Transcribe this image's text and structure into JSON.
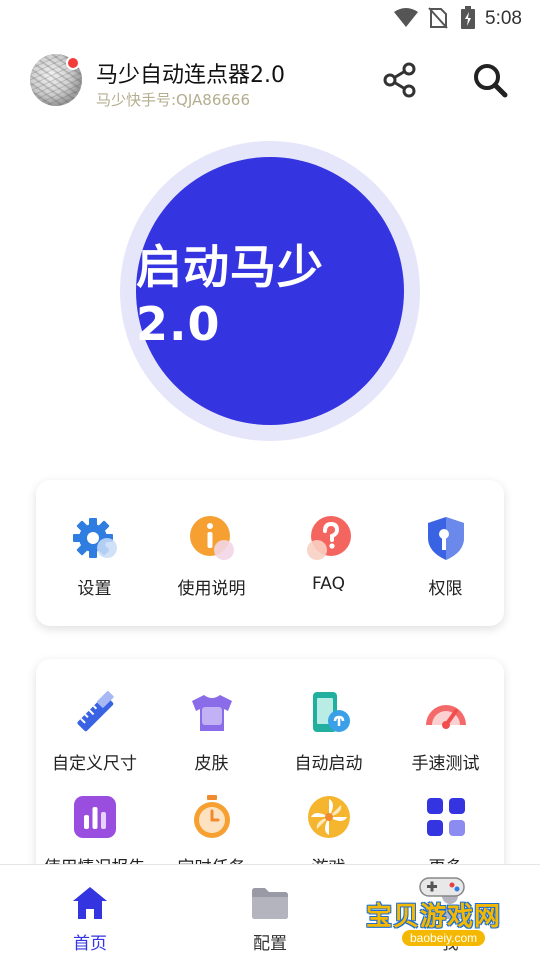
{
  "status_bar": {
    "time": "5:08",
    "wifi_icon": "wifi-icon",
    "sim_icon": "no-sim-icon",
    "battery_icon": "battery-charging-icon"
  },
  "header": {
    "title": "马少自动连点器2.0",
    "subtitle": "马少快手号:QJA86666",
    "share_icon": "share-icon",
    "search_icon": "search-icon"
  },
  "start_button": {
    "label": "启动马少2.0"
  },
  "colors": {
    "accent": "#3434e0",
    "ring": "#e6e6fb",
    "subtitle": "#b4ad8e",
    "badge": "#f23c3c"
  },
  "quick_menu": [
    {
      "label": "设置",
      "icon": "gear-icon"
    },
    {
      "label": "使用说明",
      "icon": "info-icon"
    },
    {
      "label": "FAQ",
      "icon": "question-icon"
    },
    {
      "label": "权限",
      "icon": "shield-key-icon"
    }
  ],
  "tools_menu": [
    {
      "label": "自定义尺寸",
      "icon": "ruler-pencil-icon"
    },
    {
      "label": "皮肤",
      "icon": "tshirt-icon"
    },
    {
      "label": "自动启动",
      "icon": "phone-link-icon"
    },
    {
      "label": "手速测试",
      "icon": "speedometer-icon"
    },
    {
      "label": "使用情况报告",
      "icon": "bar-chart-icon"
    },
    {
      "label": "定时任务",
      "icon": "stopwatch-icon"
    },
    {
      "label": "游戏",
      "icon": "pinwheel-icon"
    },
    {
      "label": "更多",
      "icon": "grid-icon"
    }
  ],
  "bottom_nav": [
    {
      "label": "首页",
      "icon": "home-icon",
      "active": true
    },
    {
      "label": "配置",
      "icon": "folder-icon",
      "active": false
    },
    {
      "label": "我",
      "icon": "user-icon",
      "active": false
    }
  ],
  "watermark": {
    "text": "宝贝游戏网",
    "url": "baobeiy.com"
  }
}
